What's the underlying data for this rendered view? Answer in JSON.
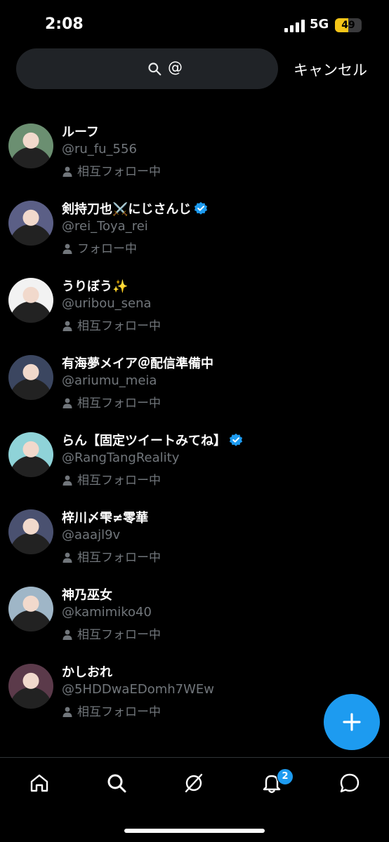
{
  "status_bar": {
    "time": "2:08",
    "network": "5G",
    "battery": "49",
    "battery_level": 0.49
  },
  "search": {
    "query": "@",
    "cancel_label": "キャンセル"
  },
  "users": [
    {
      "name": "ルーフ",
      "handle": "@ru_fu_556",
      "relationship": "相互フォロー中",
      "verified": false,
      "avatar_color": "#6b8f71"
    },
    {
      "name": "剣持刀也⚔️にじさんじ",
      "handle": "@rei_Toya_rei",
      "relationship": "フォロー中",
      "verified": true,
      "avatar_color": "#5b5f86"
    },
    {
      "name": "うりぼう✨",
      "handle": "@uribou_sena",
      "relationship": "相互フォロー中",
      "verified": false,
      "avatar_color": "#f2f2f2"
    },
    {
      "name": "有海夢メイア＠配信準備中",
      "handle": "@ariumu_meia",
      "relationship": "相互フォロー中",
      "verified": false,
      "avatar_color": "#3b4660"
    },
    {
      "name": "らん【固定ツイートみてね】",
      "handle": "@RangTangReality",
      "relationship": "相互フォロー中",
      "verified": true,
      "avatar_color": "#8fd3d8"
    },
    {
      "name": "梓川〆雫≠零華",
      "handle": "@aaajl9v",
      "relationship": "相互フォロー中",
      "verified": false,
      "avatar_color": "#4a5170"
    },
    {
      "name": "神乃巫女",
      "handle": "@kamimiko40",
      "relationship": "相互フォロー中",
      "verified": false,
      "avatar_color": "#9fb6c7"
    },
    {
      "name": "かしおれ",
      "handle": "@5HDDwaEDomh7WEw",
      "relationship": "相互フォロー中",
      "verified": false,
      "avatar_color": "#5b3a4a"
    }
  ],
  "nav": {
    "notifications_badge": "2"
  },
  "colors": {
    "accent": "#1d9bf0",
    "background": "#000000",
    "secondary_text": "#71767b"
  }
}
